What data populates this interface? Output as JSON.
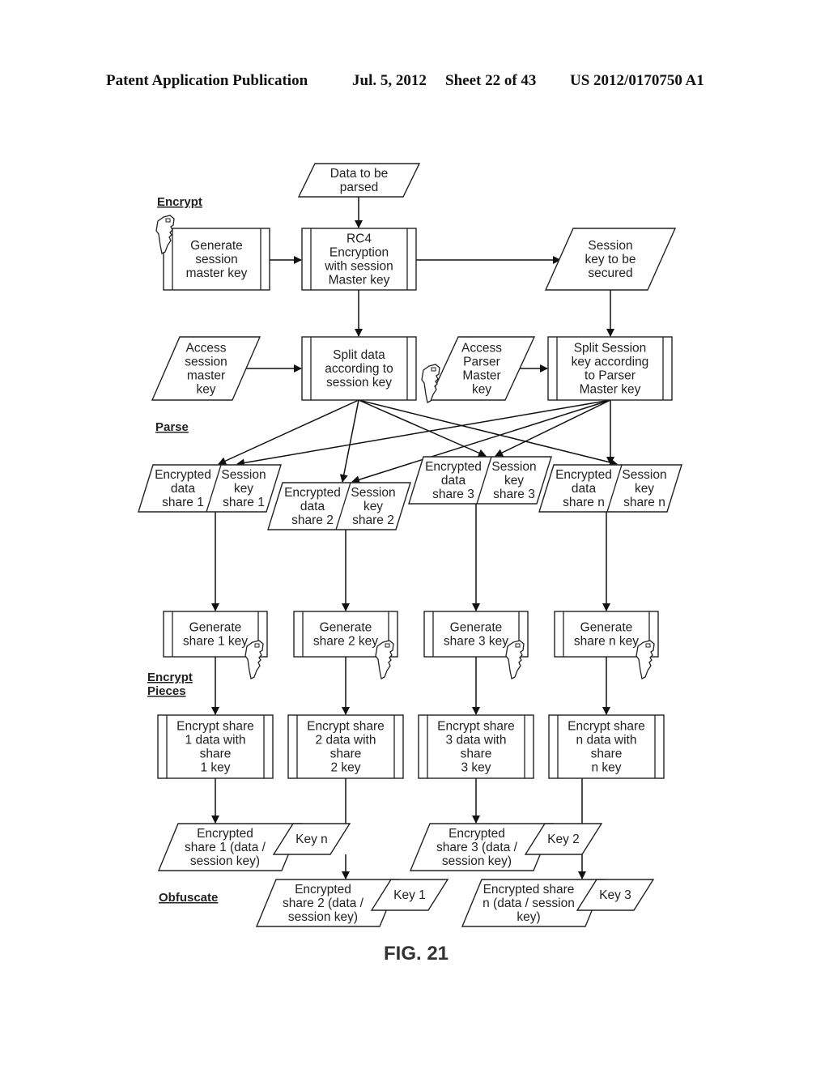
{
  "header": {
    "publication": "Patent Application Publication",
    "date": "Jul. 5, 2012",
    "sheet": "Sheet 22 of 43",
    "number": "US 2012/0170750 A1"
  },
  "sections": {
    "encrypt": "Encrypt",
    "parse": "Parse",
    "encrypt_pieces": [
      "Encrypt",
      "Pieces"
    ],
    "obfuscate": "Obfuscate"
  },
  "nodes": {
    "data_to_be_parsed": [
      "Data to be",
      "parsed"
    ],
    "generate_session_master_key": [
      "Generate",
      "session",
      "master key"
    ],
    "rc4_encryption": [
      "RC4",
      "Encryption",
      "with session",
      "Master key"
    ],
    "session_key_to_be_secured": [
      "Session",
      "key to be",
      "secured"
    ],
    "access_session_master_key": [
      "Access",
      "session",
      "master",
      "key"
    ],
    "split_data": [
      "Split data",
      "according to",
      "session key"
    ],
    "access_parser_master_key": [
      "Access",
      "Parser",
      "Master",
      "key"
    ],
    "split_session_key": [
      "Split Session",
      "key according",
      "to Parser",
      "Master key"
    ]
  },
  "shares": [
    {
      "id": "1",
      "data_share": [
        "Encrypted",
        "data",
        "share 1"
      ],
      "key_share": [
        "Session",
        "key",
        "share 1"
      ],
      "generate": [
        "Generate",
        "share 1 key"
      ],
      "encrypt": [
        "Encrypt share",
        "1 data with",
        "share",
        "1 key"
      ],
      "output": [
        "Encrypted",
        "share 1 (data /",
        "session key)"
      ],
      "paired_key": "Key n"
    },
    {
      "id": "2",
      "data_share": [
        "Encrypted",
        "data",
        "share 2"
      ],
      "key_share": [
        "Session",
        "key",
        "share 2"
      ],
      "generate": [
        "Generate",
        "share 2 key"
      ],
      "encrypt": [
        "Encrypt share",
        "2 data with",
        "share",
        "2 key"
      ],
      "output": [
        "Encrypted",
        "share 2 (data /",
        "session key)"
      ],
      "paired_key": "Key 1"
    },
    {
      "id": "3",
      "data_share": [
        "Encrypted",
        "data",
        "share 3"
      ],
      "key_share": [
        "Session",
        "key",
        "share 3"
      ],
      "generate": [
        "Generate",
        "share 3 key"
      ],
      "encrypt": [
        "Encrypt share",
        "3 data with",
        "share",
        "3 key"
      ],
      "output": [
        "Encrypted",
        "share 3 (data /",
        "session key)"
      ],
      "paired_key": "Key 2"
    },
    {
      "id": "n",
      "data_share": [
        "Encrypted",
        "data",
        "share n"
      ],
      "key_share": [
        "Session",
        "key",
        "share n"
      ],
      "generate": [
        "Generate",
        "share n key"
      ],
      "encrypt": [
        "Encrypt share",
        "n data with",
        "share",
        "n key"
      ],
      "output": [
        "Encrypted share",
        "n (data / session",
        "key)"
      ],
      "paired_key": "Key 3"
    }
  ],
  "figure_label": "FIG. 21"
}
